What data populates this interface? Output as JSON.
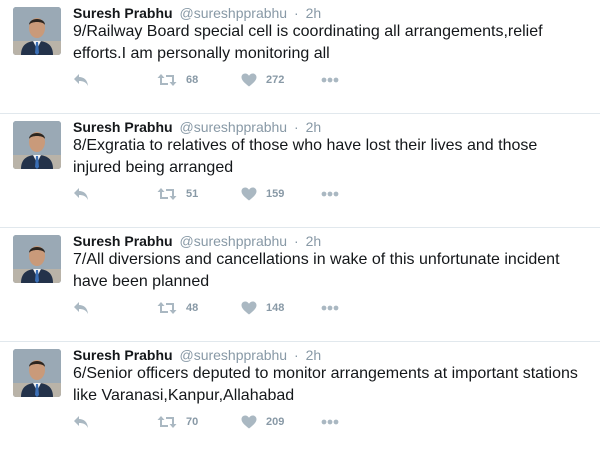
{
  "tweets": [
    {
      "name": "Suresh Prabhu",
      "handle": "@sureshpprabhu",
      "separator": "·",
      "time": "2h",
      "text": "9/Railway Board special cell is coordinating all arrangements,relief efforts.I am personally monitoring all",
      "retweets": "68",
      "likes": "272"
    },
    {
      "name": "Suresh Prabhu",
      "handle": "@sureshpprabhu",
      "separator": "·",
      "time": "2h",
      "text": "8/Exgratia to relatives of those who have lost their lives and those injured being arranged",
      "retweets": "51",
      "likes": "159"
    },
    {
      "name": "Suresh Prabhu",
      "handle": "@sureshpprabhu",
      "separator": "·",
      "time": "2h",
      "text": "7/All diversions and cancellations in wake of this unfortunate incident have been planned",
      "retweets": "48",
      "likes": "148"
    },
    {
      "name": "Suresh Prabhu",
      "handle": "@sureshpprabhu",
      "separator": "·",
      "time": "2h",
      "text": "6/Senior officers deputed to monitor arrangements at important stations like Varanasi,Kanpur,Allahabad",
      "retweets": "70",
      "likes": "209"
    }
  ],
  "icons": {
    "avatar": "avatar-photo",
    "reply": "reply-icon",
    "retweet": "retweet-icon",
    "like": "heart-icon",
    "more": "more-dots-icon"
  },
  "colors": {
    "text": "#14171a",
    "muted": "#8899a6",
    "icon": "#aab8c2",
    "divider": "#e1e8ed"
  }
}
